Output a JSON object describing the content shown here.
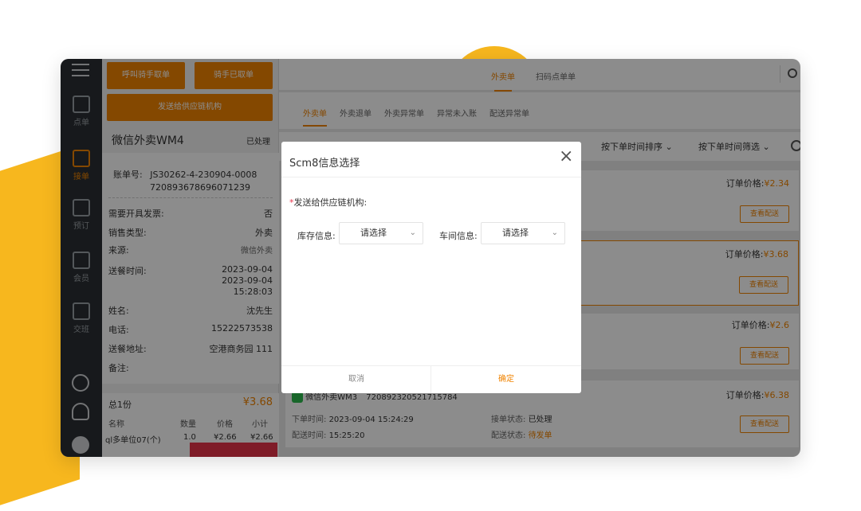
{
  "nav": {
    "items": [
      {
        "label": "点单",
        "icon": "fork-knife-icon"
      },
      {
        "label": "接单",
        "icon": "clipboard-icon"
      },
      {
        "label": "预订",
        "icon": "calendar-check-icon"
      },
      {
        "label": "会员",
        "icon": "crown-icon"
      },
      {
        "label": "交班",
        "icon": "yen-box-icon"
      }
    ]
  },
  "left": {
    "btn_call_rider": "呼叫骑手取单",
    "btn_rider_taken": "骑手已取单",
    "btn_send_supply": "发送给供应链机构",
    "title": "微信外卖WM4",
    "status": "已处理",
    "account_label": "账单号:",
    "account_no": "JS30262-4-230904-0008",
    "account_no2": "720893678696071239",
    "fields": [
      {
        "label": "需要开具发票:",
        "value": "否"
      },
      {
        "label": "销售类型:",
        "value": "外卖"
      },
      {
        "label": "来源:",
        "value": "微信外卖"
      },
      {
        "label": "送餐时间:",
        "value": "2023-09-04"
      }
    ],
    "time2": "2023-09-04",
    "time3": "15:28:03",
    "fields2": [
      {
        "label": "姓名:",
        "value": "沈先生"
      },
      {
        "label": "电话:",
        "value": "15222573538"
      },
      {
        "label": "送餐地址:",
        "value": "空港商务园 111"
      },
      {
        "label": "备注:",
        "value": ""
      }
    ],
    "total_label": "总1份",
    "total_value": "¥3.68",
    "table_headers": [
      "名称",
      "数量",
      "价格",
      "小计"
    ],
    "table_row": [
      "ql多单位07(个)",
      "1.0",
      "¥2.66",
      "¥2.66"
    ]
  },
  "right": {
    "top_tabs": [
      "外卖单",
      "扫码点单单"
    ],
    "sub_tabs": [
      "外卖单",
      "外卖退单",
      "外卖异常单",
      "异常未入账",
      "配送异常单"
    ],
    "sort_label": "按下单时间排序",
    "filter_label": "按下单时间筛选",
    "orders": [
      {
        "price_label": "订单价格:",
        "price": "¥2.34",
        "btn": "查看配送"
      },
      {
        "price_label": "订单价格:",
        "price": "¥3.68",
        "btn": "查看配送"
      },
      {
        "price_label": "订单价格:",
        "price": "¥2.6",
        "btn": "查看配送"
      },
      {
        "price_label": "订单价格:",
        "price": "¥6.38",
        "btn": "查看配送"
      }
    ],
    "last_order": {
      "title": "微信外卖WM3",
      "number": "720892320521715784",
      "order_time_label": "下单时间:",
      "order_time": "2023-09-04 15:24:29",
      "delivery_time_label": "配送时间:",
      "delivery_time": "15:25:20",
      "accept_label": "接单状态:",
      "accept_value": "已处理",
      "delivery_label": "配送状态:",
      "delivery_value": "待发单"
    }
  },
  "dialog": {
    "title": "Scm8信息选择",
    "required_label": "发送给供应链机构:",
    "stock_label": "库存信息:",
    "stock_placeholder": "请选择",
    "workshop_label": "车间信息:",
    "workshop_placeholder": "请选择",
    "cancel": "取消",
    "confirm": "确定"
  },
  "colors": {
    "accent": "#f08300",
    "nav_bg": "#2b2f33",
    "decor": "#f7b71e"
  }
}
